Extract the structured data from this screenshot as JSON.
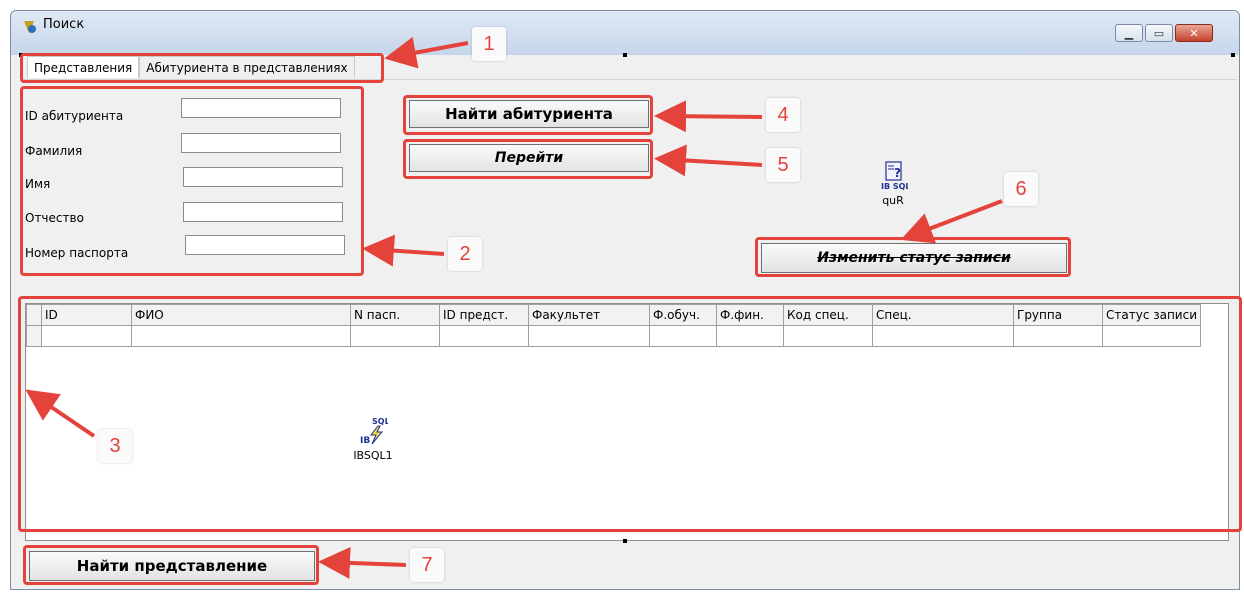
{
  "window": {
    "title": "Поиск",
    "controls": [
      "minimize",
      "maximize",
      "close"
    ]
  },
  "tabs": [
    {
      "label": "Представления",
      "active": true
    },
    {
      "label": "Абитуриента в представлениях",
      "active": false
    }
  ],
  "form": {
    "fields": [
      {
        "label": "ID абитуриента",
        "value": ""
      },
      {
        "label": "Фамилия",
        "value": ""
      },
      {
        "label": "Имя",
        "value": ""
      },
      {
        "label": "Отчество",
        "value": ""
      },
      {
        "label": "Номер паспорта",
        "value": ""
      }
    ]
  },
  "buttons": {
    "find_applicant": "Найти абитуриента",
    "go": "Перейти",
    "change_status": "Изменить статус записи",
    "find_view": "Найти представление"
  },
  "components": {
    "quR": {
      "caption": "quR",
      "icon": "ib-sql-query-icon"
    },
    "ibsql1": {
      "caption": "IBSQL1",
      "icon": "ib-sql-lightning-icon"
    }
  },
  "grid": {
    "columns": [
      "ID",
      "ФИО",
      "N пасп.",
      "ID предст.",
      "Факультет",
      "Ф.обуч.",
      "Ф.фин.",
      "Код спец.",
      "Спец.",
      "Группа",
      "Статус записи"
    ],
    "rows": [
      [
        "",
        "",
        "",
        "",
        "",
        "",
        "",
        "",
        "",
        "",
        ""
      ]
    ]
  },
  "annotations": [
    "1",
    "2",
    "3",
    "4",
    "5",
    "6",
    "7"
  ],
  "colors": {
    "annotation": "#e4433c"
  }
}
